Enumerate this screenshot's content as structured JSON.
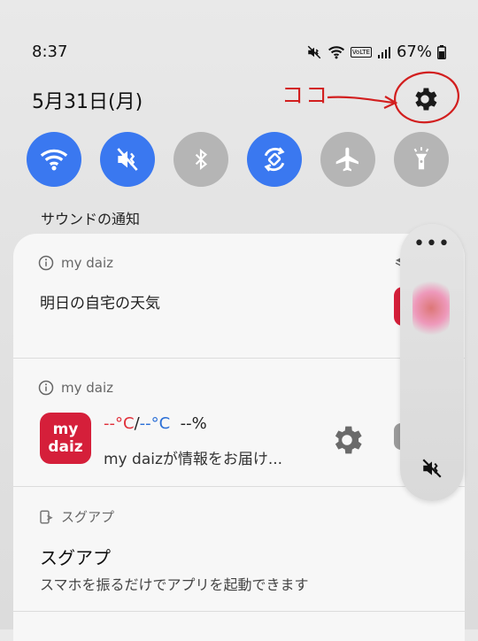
{
  "status_bar": {
    "time": "8:37",
    "battery": "67%",
    "icons": [
      "mute-icon",
      "wifi-icon",
      "volte-icon",
      "signal-icon",
      "battery-icon"
    ],
    "volte_label": "VoLTE"
  },
  "header": {
    "date": "5月31日(月)",
    "settings_icon": "gear-icon"
  },
  "annotation": {
    "label": "ココ",
    "color": "#d21f1f"
  },
  "quick_settings": [
    {
      "name": "wifi",
      "icon": "wifi-icon",
      "state": "on"
    },
    {
      "name": "sound",
      "icon": "mute-icon",
      "state": "on"
    },
    {
      "name": "bluetooth",
      "icon": "bluetooth-icon",
      "state": "off"
    },
    {
      "name": "auto-rotate",
      "icon": "rotate-icon",
      "state": "on"
    },
    {
      "name": "airplane",
      "icon": "airplane-icon",
      "state": "off"
    },
    {
      "name": "flashlight",
      "icon": "flashlight-icon",
      "state": "off"
    }
  ],
  "colors": {
    "accent_on": "#3a78f0",
    "off": "#b5b5b5",
    "brand_red": "#d51f3a"
  },
  "section_title": "サウンドの通知",
  "notifications": [
    {
      "app": "my daiz",
      "body": "明日の自宅の天気"
    },
    {
      "app": "my daiz",
      "app_icon_lines": [
        "my",
        "daiz"
      ],
      "temp_high": "--°C",
      "separator": "/",
      "temp_low": "--°C",
      "humidity": "--%",
      "text": "my daizが情報をお届け..."
    },
    {
      "app": "スグアプ",
      "title": "スグアプ",
      "text": "スマホを振るだけでアプリを起動できます"
    }
  ],
  "side_panel": {
    "menu": "•••"
  }
}
